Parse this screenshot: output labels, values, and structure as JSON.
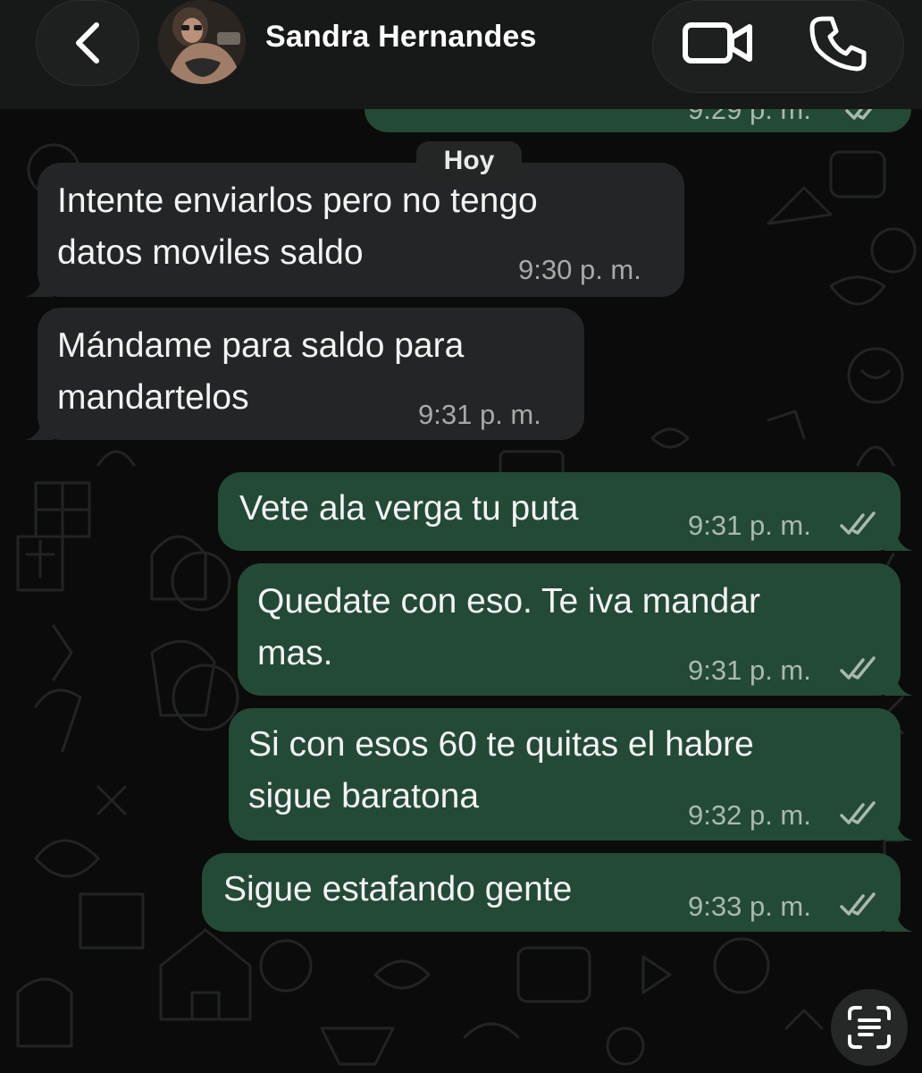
{
  "header": {
    "contact_name": "Sandra Hernandes",
    "icons": {
      "back": "chevron-left-icon",
      "video": "video-camera-icon",
      "phone": "phone-icon"
    }
  },
  "date_separator": "Hoy",
  "previous_message_time": "9:29 p. m.",
  "messages": [
    {
      "direction": "incoming",
      "lines": [
        "Intente enviarlos pero no tengo",
        "datos moviles saldo"
      ],
      "time": "9:30 p. m."
    },
    {
      "direction": "incoming",
      "lines": [
        "Mándame para saldo para",
        "mandartelos"
      ],
      "time": "9:31 p. m."
    },
    {
      "direction": "outgoing",
      "lines": [
        "Vete ala verga tu puta"
      ],
      "time": "9:31 p. m.",
      "status": "delivered"
    },
    {
      "direction": "outgoing",
      "lines": [
        "Quedate con eso. Te iva mandar",
        "mas."
      ],
      "time": "9:31 p. m.",
      "status": "delivered"
    },
    {
      "direction": "outgoing",
      "lines": [
        "Si con esos 60 te quitas el habre",
        "sigue baratona"
      ],
      "time": "9:32 p. m.",
      "status": "delivered"
    },
    {
      "direction": "outgoing",
      "lines": [
        "Sigue estafando gente"
      ],
      "time": "9:33 p. m.",
      "status": "delivered"
    }
  ],
  "colors": {
    "background": "#0b0b0b",
    "header": "#171918",
    "incoming_bubble": "#232526",
    "outgoing_bubble": "#234a36",
    "timestamp": "#a7aaa8"
  },
  "scan_button_icon": "live-text-scan-icon"
}
